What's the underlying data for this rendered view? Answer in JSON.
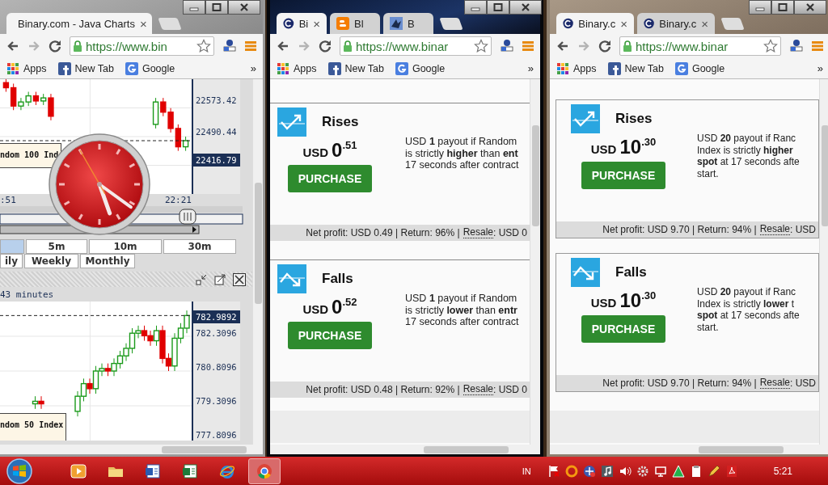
{
  "windows": [
    {
      "kind": "charts",
      "tabs": [
        {
          "kind": "binary",
          "title": "Binary.com - Java Charts",
          "close": "×",
          "selected": true
        }
      ],
      "url": "https://www.bin",
      "bookmarks": [
        {
          "kind": "apps",
          "label": "Apps"
        },
        {
          "kind": "facebook",
          "label": "New Tab"
        },
        {
          "kind": "google",
          "label": "Google"
        }
      ],
      "bookmarks_more": "»",
      "charts": {
        "upper": {
          "axis_labels": [
            "22573.42",
            "22490.44"
          ],
          "last_price": "22416.79",
          "legend": "ndom 100 Ind",
          "time_labels": [
            ":51",
            "22:21"
          ]
        },
        "intervals": [
          {
            "label": "5m",
            "selected": false
          },
          {
            "label": "10m",
            "selected": false
          },
          {
            "label": "30m",
            "selected": false
          }
        ],
        "periods": [
          {
            "label": "ily",
            "selected": false
          },
          {
            "label": "Weekly",
            "selected": false
          },
          {
            "label": "Monthly",
            "selected": false
          }
        ],
        "lower": {
          "caption": "43 minutes",
          "last_price": "782.9892",
          "axis_labels": [
            "782.3096",
            "780.8096",
            "779.3096",
            "777.8096"
          ],
          "legend": "ndom 50 Index"
        }
      }
    },
    {
      "kind": "contracts",
      "tabs": [
        {
          "kind": "binary",
          "title": "Bi",
          "close": "×",
          "selected": true
        },
        {
          "kind": "blogger",
          "title": "Bl",
          "selected": false
        },
        {
          "kind": "bird",
          "title": "B",
          "selected": false
        }
      ],
      "url": "https://www.binar",
      "bookmarks": [
        {
          "kind": "apps",
          "label": "Apps"
        },
        {
          "kind": "facebook",
          "label": "New Tab"
        },
        {
          "kind": "google",
          "label": "Google"
        }
      ],
      "bookmarks_more": "»",
      "contracts": [
        {
          "kind": "rise",
          "title": "Rises",
          "currency": "USD",
          "amount": "0",
          "cents": ".51",
          "button": "PURCHASE",
          "description": [
            "USD **1** payout if Random",
            "is strictly **higher** than **ent**",
            "17 seconds after contract"
          ],
          "summary": "Net profit: USD 0.49 | Return: 96% |",
          "resale": "Resale",
          "resale_value": ": USD 0"
        },
        {
          "kind": "fall",
          "title": "Falls",
          "currency": "USD",
          "amount": "0",
          "cents": ".52",
          "button": "PURCHASE",
          "description": [
            "USD **1** payout if Random",
            "is strictly **lower** than **entr**",
            "17 seconds after contract"
          ],
          "summary": "Net profit: USD 0.48 | Return: 92% |",
          "resale": "Resale",
          "resale_value": ": USD 0"
        }
      ]
    },
    {
      "kind": "contracts",
      "tabs": [
        {
          "kind": "binary",
          "title": "Binary.c",
          "close": "×",
          "selected": true
        },
        {
          "kind": "binary",
          "title": "Binary.c",
          "close": "×",
          "selected": false
        }
      ],
      "url": "https://www.binar",
      "bookmarks": [
        {
          "kind": "apps",
          "label": "Apps"
        },
        {
          "kind": "facebook",
          "label": "New Tab"
        },
        {
          "kind": "google",
          "label": "Google"
        }
      ],
      "bookmarks_more": "»",
      "contracts": [
        {
          "kind": "rise",
          "title": "Rises",
          "currency": "USD",
          "amount": "10",
          "cents": ".30",
          "button": "PURCHASE",
          "description": [
            "USD **20** payout if Ranc",
            "Index is strictly **higher**",
            "**spot** at 17 seconds afte",
            "start."
          ],
          "summary": "Net profit: USD 9.70 | Return: 94% |",
          "resale": "Resale",
          "resale_value": ": USD"
        },
        {
          "kind": "fall",
          "title": "Falls",
          "currency": "USD",
          "amount": "10",
          "cents": ".30",
          "button": "PURCHASE",
          "description": [
            "USD **20** payout if Ranc",
            "Index is strictly **lower** t",
            "**spot** at 17 seconds afte",
            "start."
          ],
          "summary": "Net profit: USD 9.70 | Return: 94% |",
          "resale": "Resale",
          "resale_value": ": USD"
        }
      ]
    }
  ],
  "taskbar": {
    "apps": [
      {
        "kind": "media",
        "selected": false
      },
      {
        "kind": "folder",
        "selected": false
      },
      {
        "kind": "word",
        "selected": false
      },
      {
        "kind": "excel",
        "selected": false
      },
      {
        "kind": "ie",
        "selected": false
      },
      {
        "kind": "chrome",
        "selected": true
      }
    ],
    "language": "IN",
    "tray": [
      {
        "kind": "flag"
      },
      {
        "kind": "ring"
      },
      {
        "kind": "net3g"
      },
      {
        "kind": "music"
      },
      {
        "kind": "speaker"
      },
      {
        "kind": "gear"
      },
      {
        "kind": "monitor"
      },
      {
        "kind": "triangle"
      },
      {
        "kind": "clipboard"
      },
      {
        "kind": "pencil"
      },
      {
        "kind": "pdf"
      }
    ],
    "clock": "5:21"
  }
}
